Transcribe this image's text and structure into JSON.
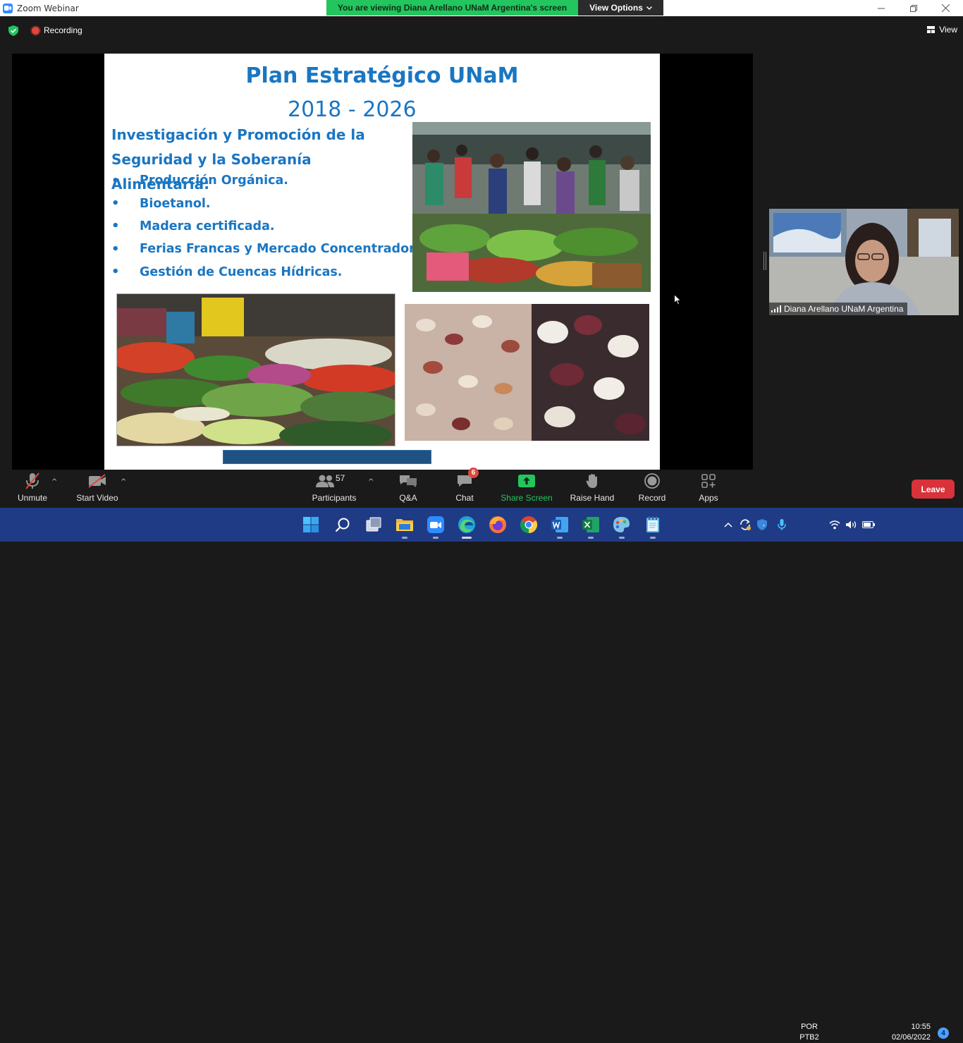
{
  "window": {
    "title": "Zoom Webinar",
    "minimize_icon": "minimize-icon",
    "maximize_icon": "restore-icon",
    "close_icon": "close-icon"
  },
  "banner": {
    "message": "You are viewing Diana Arellano UNaM  Argentina's screen",
    "view_options": "View Options",
    "color": "#23c55e"
  },
  "topbar": {
    "recording_label": "Recording",
    "view_label": "View",
    "security_color": "#23c55e"
  },
  "slide": {
    "title": "Plan Estratégico UNaM",
    "years": "2018 - 2026",
    "heading_line1": "Investigación y Promoción de la",
    "heading_line2": "Seguridad y la Soberanía Alimentaria:",
    "bullet_char": "•",
    "bullets": [
      "Producción Orgánica.",
      "Bioetanol.",
      "Madera certificada.",
      "Ferias Francas y Mercado Concentrador.",
      "Gestión de Cuencas Hídricas."
    ],
    "text_color": "#1a76c2"
  },
  "participant": {
    "name": "Diana Arellano UNaM Argentina"
  },
  "toolbar": {
    "unmute": "Unmute",
    "start_video": "Start Video",
    "participants": "Participants",
    "participants_count": "57",
    "qa": "Q&A",
    "chat": "Chat",
    "chat_badge": "6",
    "share_screen": "Share Screen",
    "raise_hand": "Raise Hand",
    "record": "Record",
    "apps": "Apps",
    "leave": "Leave",
    "share_color": "#23c55e",
    "leave_color": "#d8323b"
  },
  "taskbar": {
    "language": "POR",
    "layout": "PTB2",
    "time": "10:55",
    "date": "02/06/2022",
    "notifications": "4",
    "apps": [
      "start-icon",
      "search-icon",
      "task-view-icon",
      "file-explorer-icon",
      "zoom-icon",
      "edge-icon",
      "firefox-icon",
      "chrome-icon",
      "word-icon",
      "excel-icon",
      "paint-icon",
      "notepad-icon"
    ]
  }
}
